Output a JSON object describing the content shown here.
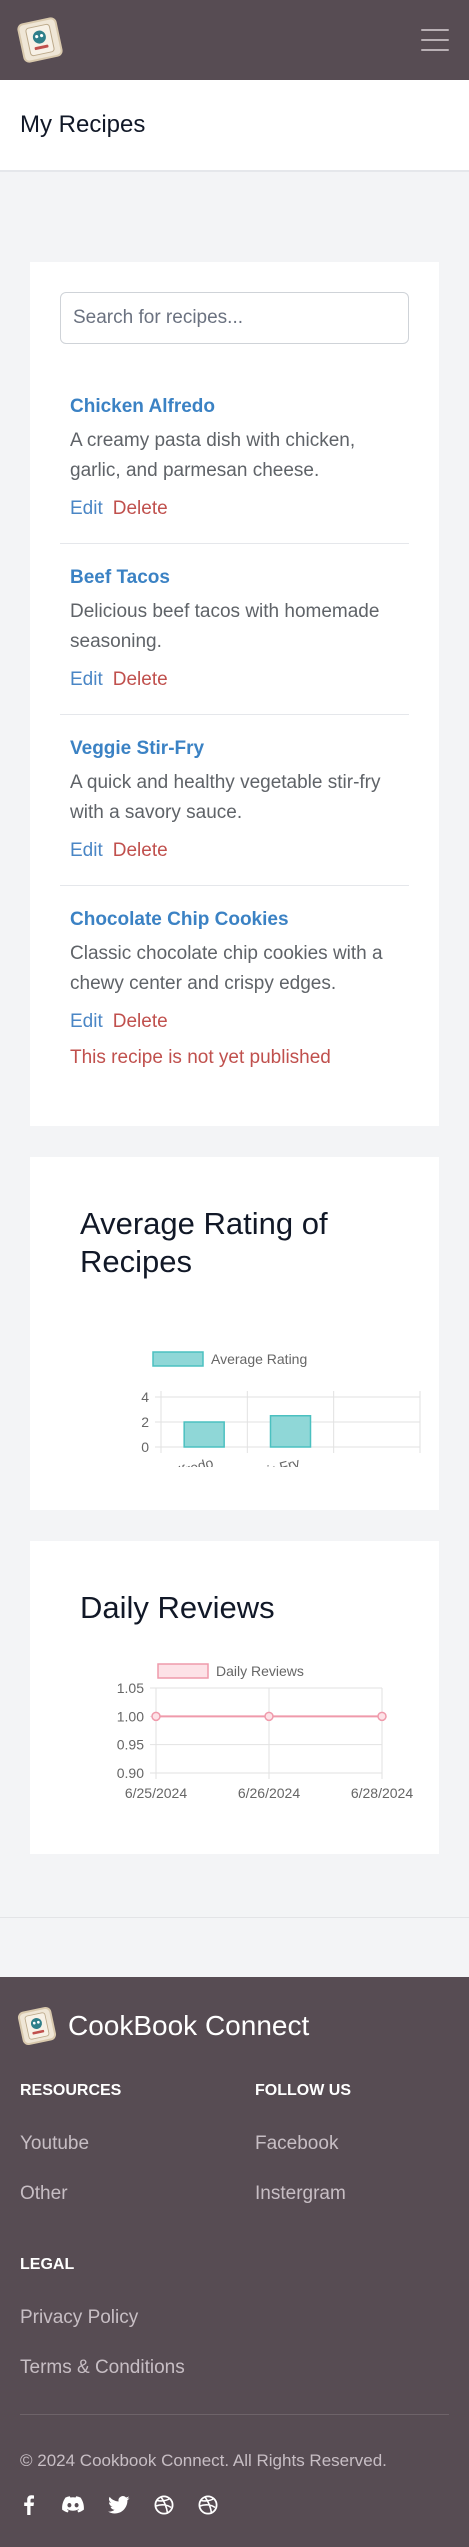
{
  "brand": {
    "name": "CookBook Connect"
  },
  "page": {
    "title": "My Recipes"
  },
  "search": {
    "placeholder": "Search for recipes..."
  },
  "recipes": [
    {
      "name": "Chicken Alfredo",
      "description": "A creamy pasta dish with chicken, garlic, and parmesan cheese.",
      "edit": "Edit",
      "delete": "Delete",
      "notice": ""
    },
    {
      "name": "Beef Tacos",
      "description": "Delicious beef tacos with homemade seasoning.",
      "edit": "Edit",
      "delete": "Delete",
      "notice": ""
    },
    {
      "name": "Veggie Stir-Fry",
      "description": "A quick and healthy vegetable stir-fry with a savory sauce.",
      "edit": "Edit",
      "delete": "Delete",
      "notice": ""
    },
    {
      "name": "Chocolate Chip Cookies",
      "description": "Classic chocolate chip cookies with a chewy center and crispy edges.",
      "edit": "Edit",
      "delete": "Delete",
      "notice": "This recipe is not yet published"
    }
  ],
  "charts": {
    "rating": {
      "heading": "Average Rating of Recipes"
    },
    "reviews": {
      "heading": "Daily Reviews"
    }
  },
  "chart_data": [
    {
      "type": "bar",
      "categories": [
        "Chicken Alfredo",
        "Veggie Stir-Fry",
        ""
      ],
      "series": [
        {
          "name": "Average Rating",
          "values": [
            2,
            2.5,
            null
          ]
        }
      ],
      "ylim": [
        0,
        4
      ],
      "yticks": [
        "4",
        "2",
        "0"
      ],
      "legend": "top",
      "grid": true,
      "colors": {
        "fill": "#8fd7d7",
        "stroke": "#4bc0c0"
      }
    },
    {
      "type": "line",
      "x": [
        "6/25/2024",
        "6/26/2024",
        "6/28/2024"
      ],
      "series": [
        {
          "name": "Daily Reviews",
          "values": [
            1,
            1,
            1
          ]
        }
      ],
      "ylim": [
        0.9,
        1.05
      ],
      "yticks": [
        "1.05",
        "1.00",
        "0.95",
        "0.90"
      ],
      "legend": "top",
      "grid": true,
      "colors": {
        "line": "#ef9aab",
        "fill": "#fde2e7"
      }
    }
  ],
  "footer": {
    "resources": {
      "heading": "RESOURCES",
      "links": [
        "Youtube",
        "Other"
      ]
    },
    "follow": {
      "heading": "FOLLOW US",
      "links": [
        "Facebook",
        "Instergram"
      ]
    },
    "legal": {
      "heading": "LEGAL",
      "links": [
        "Privacy Policy",
        "Terms & Conditions"
      ]
    },
    "copyright": "© 2024 Cookbook Connect. All Rights Reserved.",
    "social_icons": [
      "facebook-icon",
      "discord-icon",
      "twitter-icon",
      "dribbble-icon",
      "dribbble-icon"
    ]
  },
  "colors": {
    "nav_bg": "#574c53",
    "link_blue": "#3b82c4",
    "danger_red": "#c0504d"
  }
}
